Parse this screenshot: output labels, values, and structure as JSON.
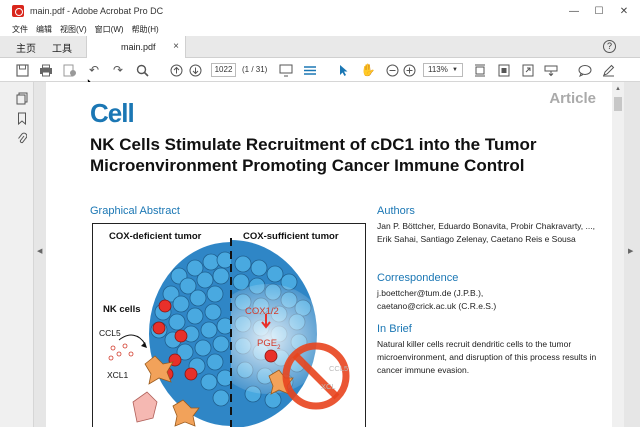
{
  "window": {
    "title": "main.pdf - Adobe Acrobat Pro DC",
    "controls": [
      "—",
      "☐",
      "✕"
    ]
  },
  "menu": [
    "文件",
    "编辑",
    "视图(V)",
    "窗口(W)",
    "帮助(H)"
  ],
  "tabs": {
    "home": "主页",
    "tools": "工具",
    "document": "main.pdf",
    "close": "×",
    "help": "?"
  },
  "toolbar": {
    "page_number": "1022",
    "page_count": "(1 / 31)",
    "zoom": "113%"
  },
  "paper": {
    "journal": "Cell",
    "article_type": "Article",
    "title": "NK Cells Stimulate Recruitment of cDC1 into the Tumor Microenvironment Promoting Cancer Immune Control",
    "graphical_abstract": {
      "heading": "Graphical Abstract",
      "left_panel": "COX-deficient tumor",
      "right_panel": "COX-sufficient tumor",
      "nk_cells": "NK cells",
      "ccl5": "CCL5",
      "xcl1": "XCL1",
      "cox": "COX1/2",
      "pge": "PGE",
      "pge_sub": "2",
      "ccl5_faded": "CCL5",
      "xcl1_faded": "XCL"
    },
    "authors_heading": "Authors",
    "authors": "Jan P. Böttcher, Eduardo Bonavita, Probir Chakravarty, ..., Erik Sahai, Santiago Zelenay, Caetano Reis e Sousa",
    "correspondence_heading": "Correspondence",
    "correspondence": [
      "j.boettcher@tum.de (J.P.B.),",
      "caetano@crick.ac.uk (C.R.e.S.)"
    ],
    "in_brief_heading": "In Brief",
    "in_brief": "Natural killer cells recruit dendritic cells to the tumor microenvironment, and disruption of this process results in cancer immune evasion."
  },
  "colors": {
    "accent": "#1b77b4",
    "tumor_cell": "#3b9ad6",
    "nk_cell": "#e8302a",
    "dc_cell": "#f2a25a",
    "prohibit": "#e8441e"
  }
}
